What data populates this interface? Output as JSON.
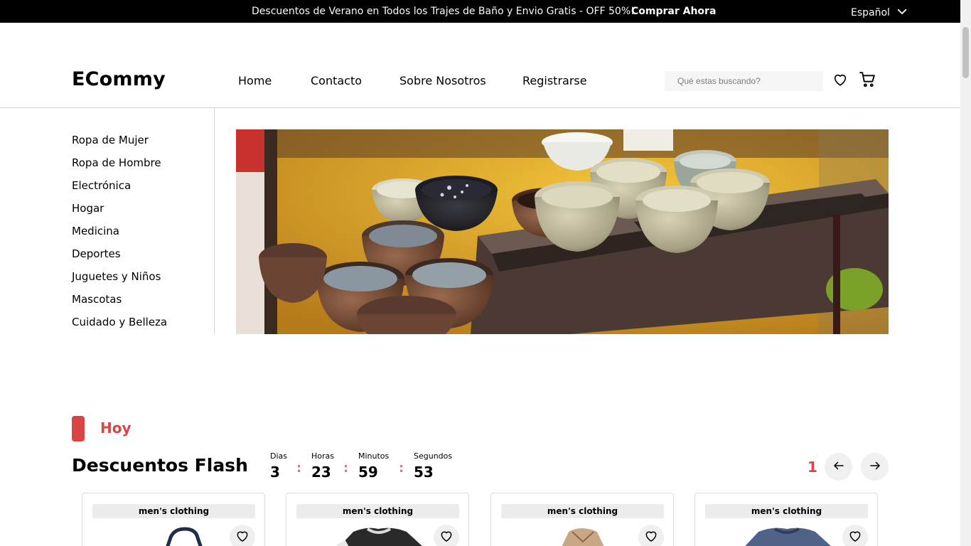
{
  "topbar": {
    "promo": "Descuentos de Verano en Todos los Trajes de Baño y Envio Gratis - OFF 50%!",
    "shop_now": "Comprar Ahora",
    "language": "Español"
  },
  "header": {
    "logo": "ECommy",
    "nav": [
      "Home",
      "Contacto",
      "Sobre Nosotros",
      "Registrarse"
    ],
    "search_placeholder": "Qué estas buscando?"
  },
  "sidebar": {
    "categories": [
      "Ropa de Mujer",
      "Ropa de Hombre",
      "Electrónica",
      "Hogar",
      "Medicina",
      "Deportes",
      "Juguetes y Niños",
      "Mascotas",
      "Cuidado y Belleza"
    ]
  },
  "flash": {
    "tag": "Hoy",
    "title": "Descuentos Flash",
    "countdown": [
      {
        "label": "Dias",
        "value": "3"
      },
      {
        "label": "Horas",
        "value": "23"
      },
      {
        "label": "Minutos",
        "value": "59"
      },
      {
        "label": "Segundos",
        "value": "53"
      }
    ],
    "separator": ":",
    "page": "1"
  },
  "products": [
    {
      "category": "men's clothing",
      "shirt_color": "#1f2e4d"
    },
    {
      "category": "men's clothing",
      "shirt_color": "#2a2a2a"
    },
    {
      "category": "men's clothing",
      "shirt_color": "#c7a784"
    },
    {
      "category": "men's clothing",
      "shirt_color": "#4f6388"
    }
  ],
  "colors": {
    "accent": "#db4444",
    "topbar_bg": "#000000"
  },
  "icons": [
    "chevron-down-icon",
    "heart-icon",
    "cart-icon",
    "arrow-left-icon",
    "arrow-right-icon"
  ]
}
